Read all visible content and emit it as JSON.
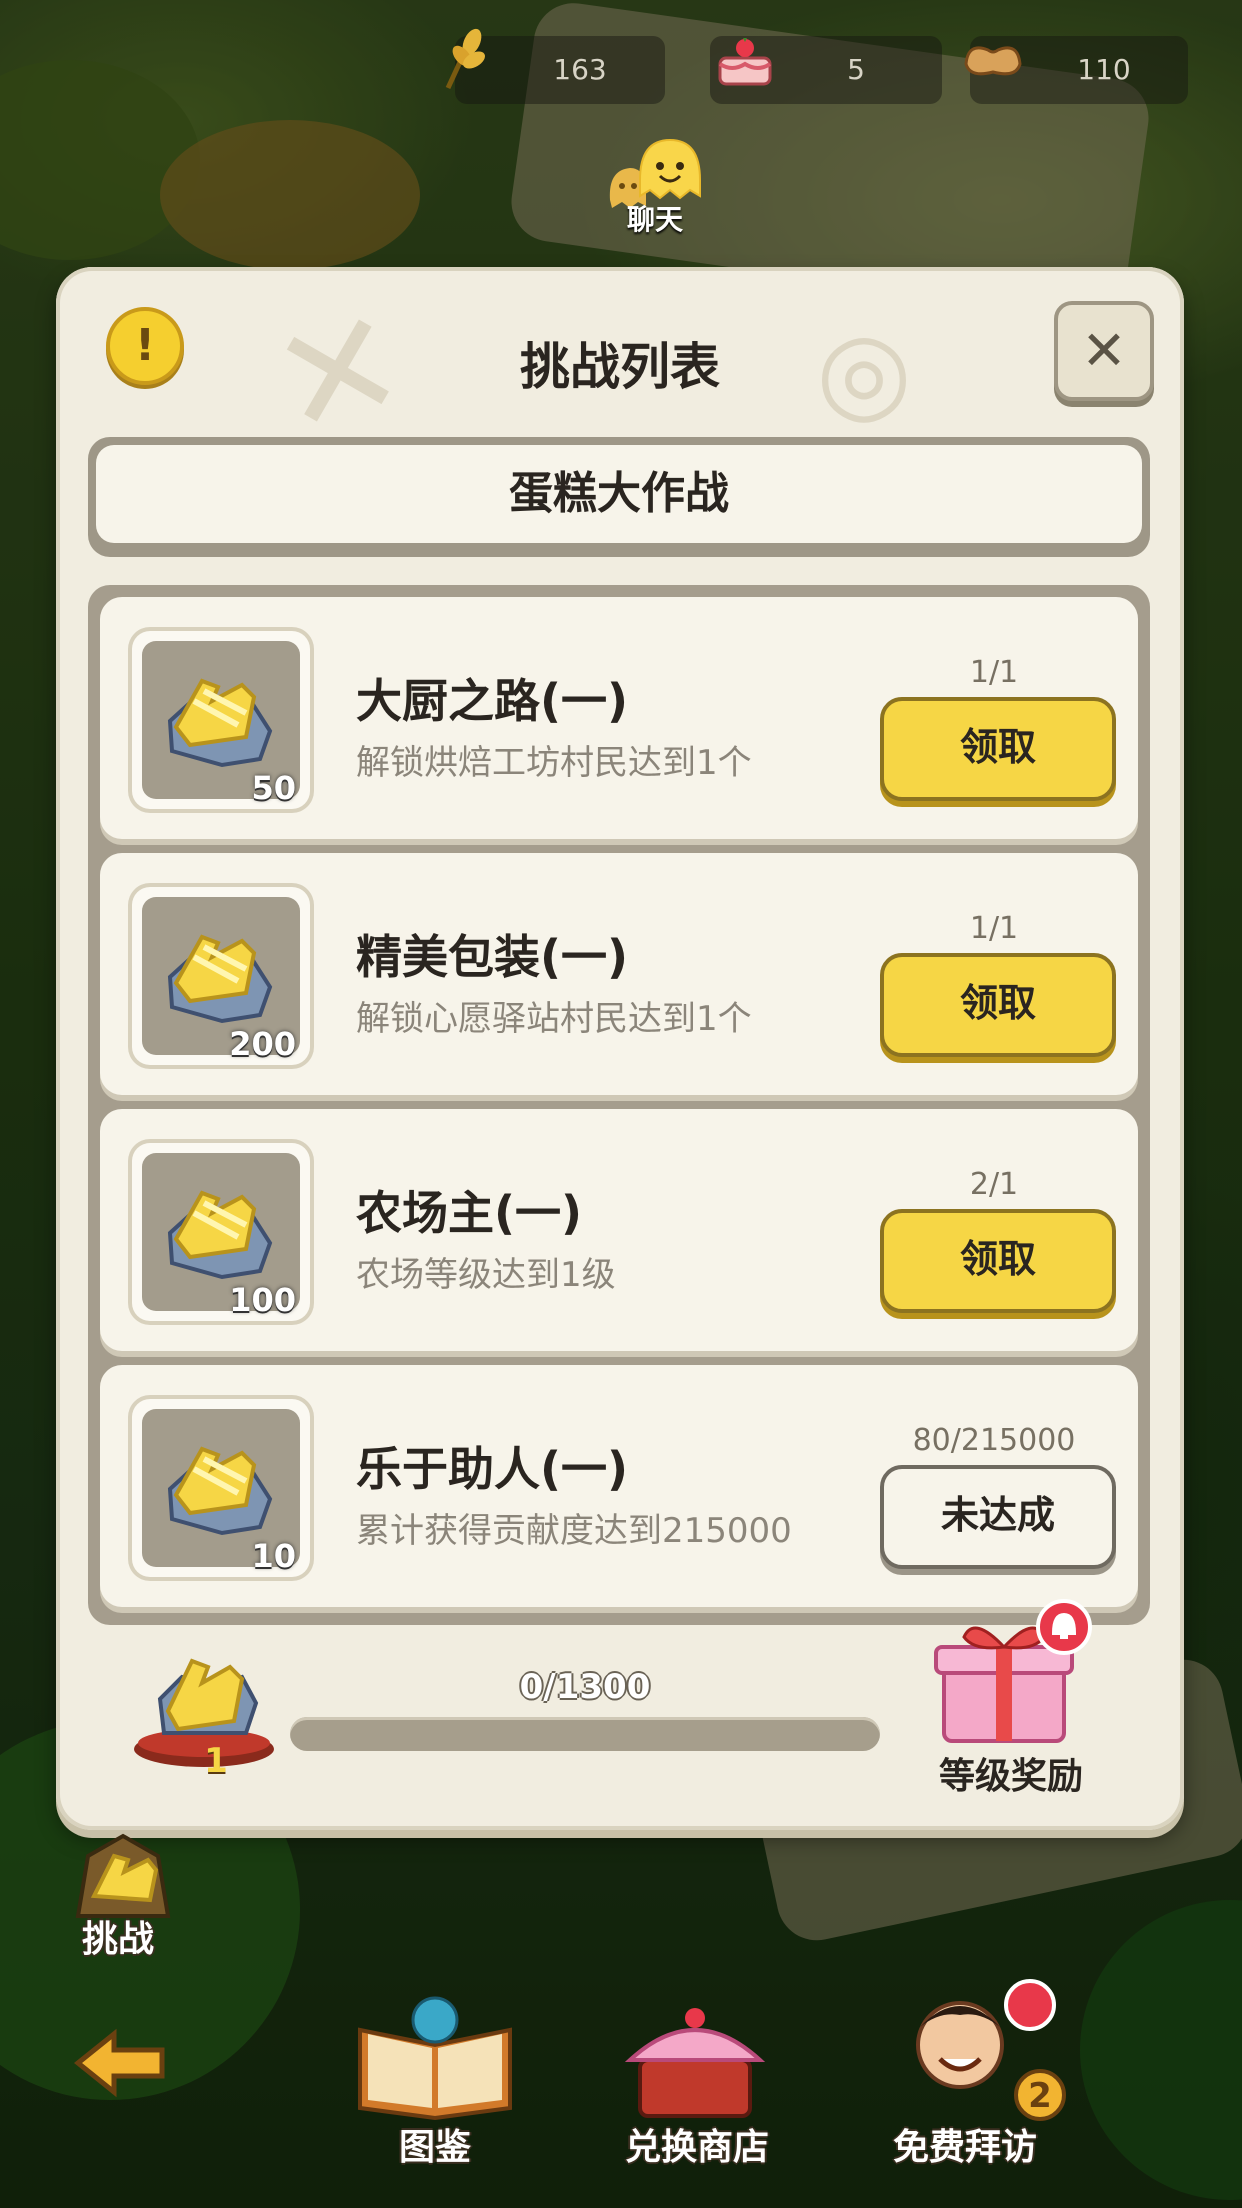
{
  "resources": [
    {
      "icon": "wheat-icon",
      "value": "163"
    },
    {
      "icon": "cake-icon",
      "value": "5"
    },
    {
      "icon": "bread-icon",
      "value": "110"
    }
  ],
  "chat": {
    "label": "聊天"
  },
  "dialog": {
    "title": "挑战列表",
    "active_tab": "蛋糕大作战",
    "challenges": [
      {
        "name": "大厨之路(一)",
        "desc": "解锁烘焙工坊村民达到1个",
        "reward": "50",
        "progress": "1/1",
        "button": "领取",
        "state": "claimable"
      },
      {
        "name": "精美包装(一)",
        "desc": "解锁心愿驿站村民达到1个",
        "reward": "200",
        "progress": "1/1",
        "button": "领取",
        "state": "claimable"
      },
      {
        "name": "农场主(一)",
        "desc": "农场等级达到1级",
        "reward": "100",
        "progress": "2/1",
        "button": "领取",
        "state": "claimable"
      },
      {
        "name": "乐于助人(一)",
        "desc": "累计获得贡献度达到215000",
        "reward": "10",
        "progress": "80/215000",
        "button": "未达成",
        "state": "incomplete"
      }
    ],
    "level": {
      "value": "1",
      "progress_text": "0/1300",
      "progress_fraction": 0.0
    },
    "level_reward_label": "等级奖励"
  },
  "side": {
    "challenge_label": "挑战"
  },
  "bottom_nav": [
    {
      "label": "图鉴",
      "icon": "book-icon"
    },
    {
      "label": "兑换商店",
      "icon": "shop-icon"
    },
    {
      "label": "免费拜访",
      "icon": "visit-icon",
      "badge": "2"
    }
  ],
  "colors": {
    "accent_yellow": "#f6d645",
    "panel": "#f1ede0"
  }
}
